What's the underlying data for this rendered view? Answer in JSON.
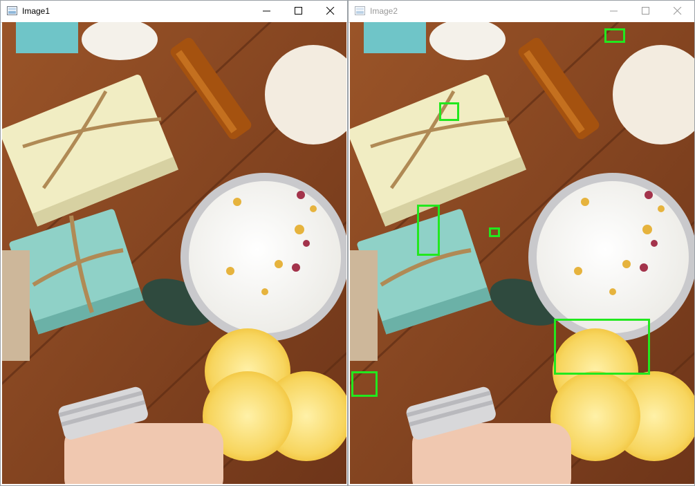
{
  "windows": [
    {
      "title": "Image1"
    },
    {
      "title": "Image2"
    }
  ],
  "icons": {
    "app": "image-window-icon",
    "minimize": "minimize-icon",
    "maximize": "maximize-icon",
    "close": "close-icon"
  },
  "colors": {
    "highlight_box": "#22e81e",
    "inactive_title": "#999999"
  }
}
